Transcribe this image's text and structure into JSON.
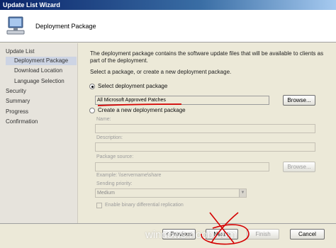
{
  "window": {
    "title": "Update List Wizard"
  },
  "header": {
    "title": "Deployment Package",
    "icon": "computer-icon"
  },
  "sidebar": {
    "items": [
      {
        "label": "Update List"
      },
      {
        "label": "Deployment Package",
        "selected": true
      },
      {
        "label": "Download Location"
      },
      {
        "label": "Language Selection"
      },
      {
        "label": "Security"
      },
      {
        "label": "Summary"
      },
      {
        "label": "Progress"
      },
      {
        "label": "Confirmation"
      }
    ]
  },
  "main": {
    "description": "The deployment package contains the software update files that will be available to clients as part of the deployment.",
    "prompt": "Select a package, or create a new deployment package.",
    "select_option": {
      "label": "Select deployment package",
      "value": "All Microsoft Approved Patches",
      "browse_label": "Browse..."
    },
    "create_option": {
      "label": "Create a new deployment package",
      "name_label": "Name:",
      "description_label": "Description:",
      "source_label": "Package source:",
      "source_browse_label": "Browse...",
      "example": "Example: \\\\servername\\share",
      "priority_label": "Sending priority:",
      "priority_value": "Medium",
      "binary_label": "Enable binary differential replication"
    }
  },
  "footer": {
    "previous_label": "< Previous",
    "next_label": "Next >",
    "finish_label": "Finish",
    "cancel_label": "Cancel",
    "watermark": "windows-noob.com"
  },
  "colors": {
    "annotation": "#d40000",
    "titlebar": "#0a246a",
    "selected": "#cdd4e4"
  }
}
